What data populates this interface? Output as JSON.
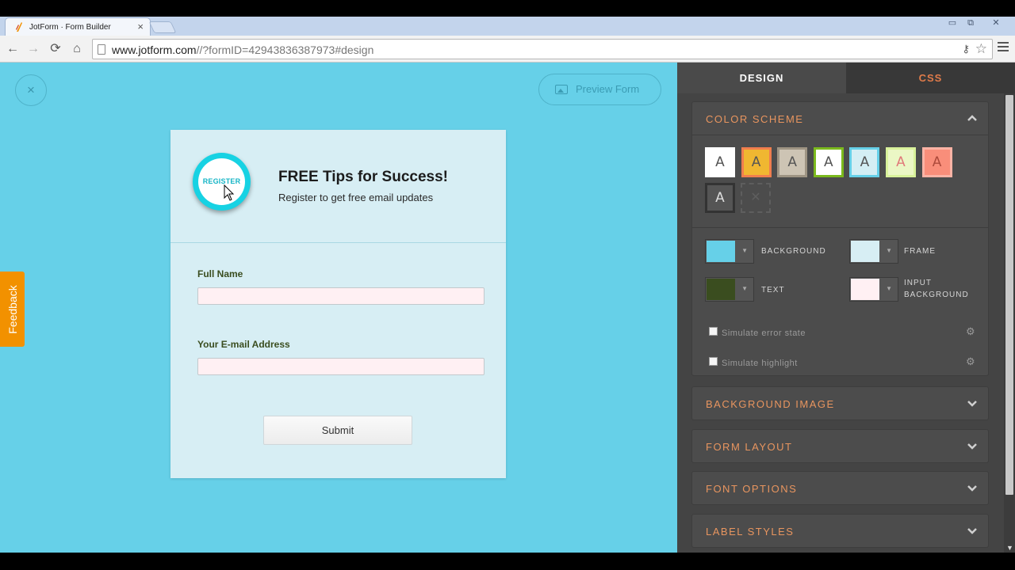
{
  "browser": {
    "tab_title": "JotForm · Form Builder",
    "tab_close": "×",
    "url_host": "www.jotform.com",
    "url_path": "//?formID=42943836387973#design",
    "window_controls": {
      "minimize": "▭",
      "restore": "⧉",
      "close": "✕"
    },
    "nav": {
      "back": "←",
      "forward": "→",
      "reload": "⟳",
      "home": "⌂"
    },
    "key_icon": "⚷",
    "star_icon": "☆"
  },
  "canvas": {
    "close_glyph": "×",
    "preview_label": "Preview Form",
    "feedback_label": "Feedback",
    "background_color": "#66d0e8"
  },
  "form": {
    "badge_text": "REGISTER",
    "title": "FREE Tips for Success!",
    "subtitle": "Register to get free email updates",
    "fields": [
      {
        "label": "Full Name",
        "value": ""
      },
      {
        "label": "Your E-mail Address",
        "value": ""
      }
    ],
    "submit_label": "Submit"
  },
  "panel": {
    "tabs": [
      {
        "label": "DESIGN",
        "active": true
      },
      {
        "label": "CSS",
        "active": false
      }
    ],
    "color_scheme": {
      "title": "COLOR SCHEME",
      "swatches": [
        {
          "letter": "A",
          "bg": "#ffffff",
          "border": "#ffffff",
          "color": "#555555"
        },
        {
          "letter": "A",
          "bg": "#f0b731",
          "border": "#f07e4e",
          "color": "#555555"
        },
        {
          "letter": "A",
          "bg": "#cdc4b4",
          "border": "#9e9483",
          "color": "#555555"
        },
        {
          "letter": "A",
          "bg": "#ffffff",
          "border": "#7bb91d",
          "color": "#555555"
        },
        {
          "letter": "A",
          "bg": "#d4eef4",
          "border": "#66d0e8",
          "color": "#555555"
        },
        {
          "letter": "A",
          "bg": "#ebf7c5",
          "border": "#d9f29b",
          "color": "#e07a7a"
        },
        {
          "letter": "A",
          "bg": "#f98e7a",
          "border": "#fbb3a5",
          "color": "#ad4a3b"
        },
        {
          "letter": "A",
          "bg": "#555555",
          "border": "#333333",
          "color": "#dddddd"
        }
      ],
      "empty_swatch": "✕",
      "pickers": [
        {
          "label": "BACKGROUND",
          "color": "#66d0e8"
        },
        {
          "label": "FRAME",
          "color": "#d7eef4"
        },
        {
          "label": "TEXT",
          "color": "#3a4d1f"
        },
        {
          "label": "INPUT BACKGROUND",
          "color": "#fff0f3"
        }
      ],
      "picker_arrow": "▼",
      "options": [
        {
          "label": "Simulate error state",
          "checked": false
        },
        {
          "label": "Simulate highlight",
          "checked": false
        }
      ],
      "gear_glyph": "⚙"
    },
    "sections": [
      {
        "title": "BACKGROUND IMAGE"
      },
      {
        "title": "FORM LAYOUT"
      },
      {
        "title": "FONT OPTIONS"
      },
      {
        "title": "LABEL STYLES"
      }
    ],
    "accent_color": "#e8955f"
  }
}
